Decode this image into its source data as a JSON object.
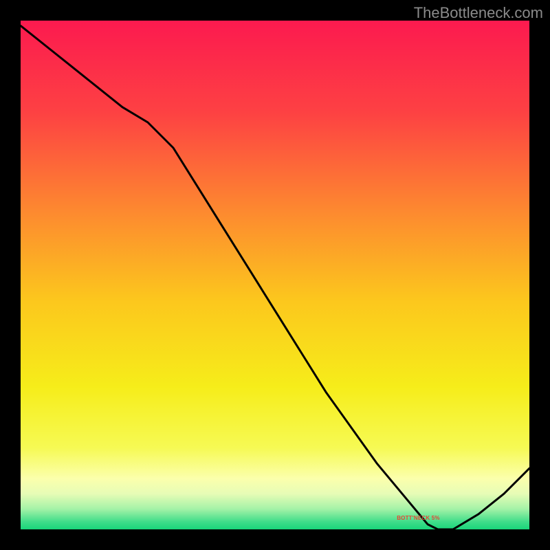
{
  "attribution": "TheBottleneck.com",
  "note_text": "BOTT'NECK 5%",
  "chart_data": {
    "type": "line",
    "title": "",
    "xlabel": "",
    "ylabel": "",
    "x": [
      0.0,
      0.05,
      0.1,
      0.15,
      0.2,
      0.25,
      0.3,
      0.35,
      0.4,
      0.45,
      0.5,
      0.55,
      0.6,
      0.65,
      0.7,
      0.75,
      0.8,
      0.82,
      0.85,
      0.9,
      0.95,
      1.0
    ],
    "values": [
      0.99,
      0.95,
      0.91,
      0.87,
      0.83,
      0.8,
      0.75,
      0.67,
      0.59,
      0.51,
      0.43,
      0.35,
      0.27,
      0.2,
      0.13,
      0.07,
      0.01,
      0.0,
      0.0,
      0.03,
      0.07,
      0.12
    ],
    "xlim": [
      0,
      1
    ],
    "ylim": [
      0,
      1
    ],
    "note": {
      "x": 0.78,
      "y": 0.02,
      "text": "BOTT'NECK 5%"
    },
    "background_gradient": {
      "direction": "vertical",
      "stops": [
        {
          "pos": 0.0,
          "color": "#fc1a4f"
        },
        {
          "pos": 0.18,
          "color": "#fd4143"
        },
        {
          "pos": 0.38,
          "color": "#fd8b2f"
        },
        {
          "pos": 0.55,
          "color": "#fcc71d"
        },
        {
          "pos": 0.72,
          "color": "#f6ed1a"
        },
        {
          "pos": 0.84,
          "color": "#f6fa54"
        },
        {
          "pos": 0.9,
          "color": "#fbffac"
        },
        {
          "pos": 0.93,
          "color": "#e7fcb6"
        },
        {
          "pos": 0.96,
          "color": "#a4f2a7"
        },
        {
          "pos": 0.985,
          "color": "#40dd8a"
        },
        {
          "pos": 1.0,
          "color": "#19d57a"
        }
      ]
    }
  }
}
